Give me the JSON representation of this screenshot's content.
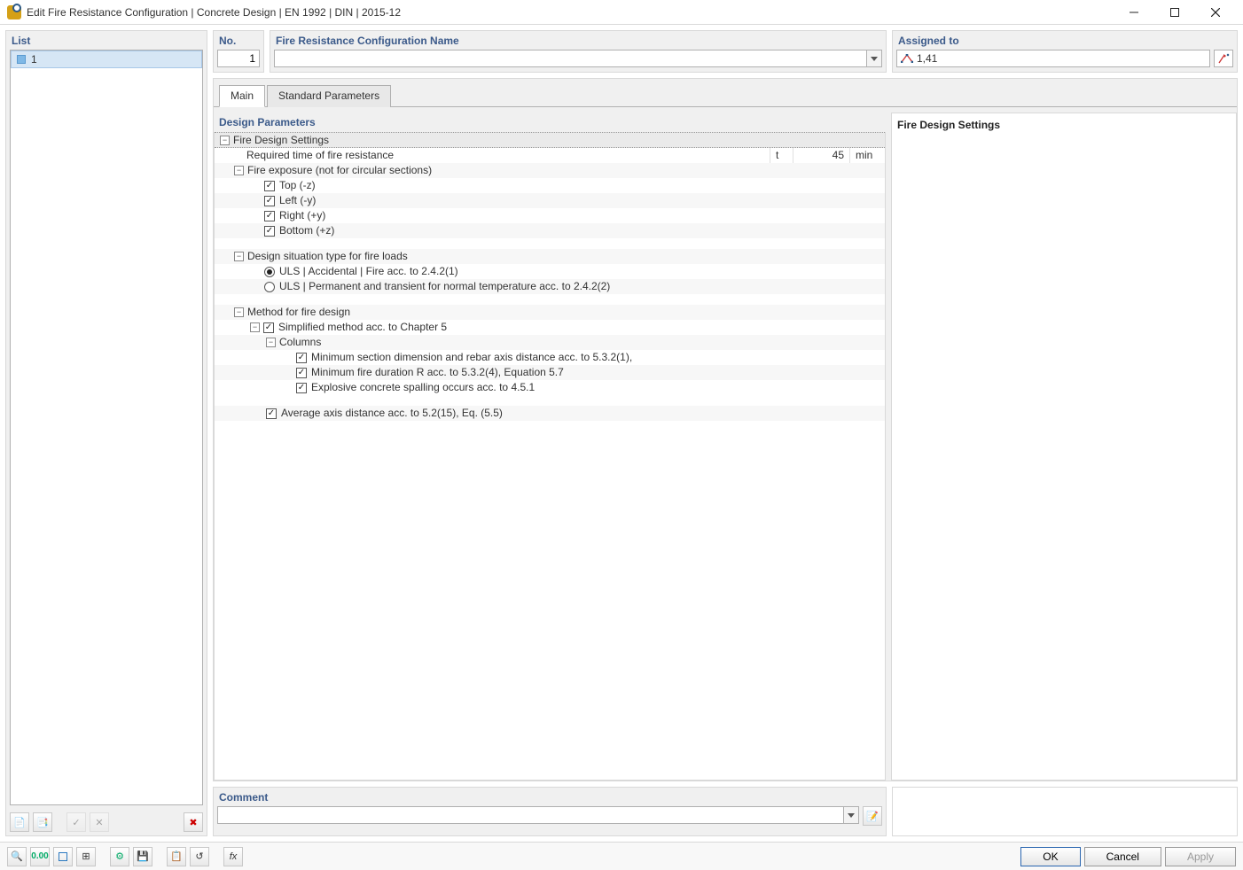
{
  "window": {
    "title": "Edit Fire Resistance Configuration | Concrete Design | EN 1992 | DIN | 2015-12"
  },
  "left": {
    "heading": "List",
    "items": [
      {
        "no": "1"
      }
    ]
  },
  "header": {
    "no_label": "No.",
    "no_value": "1",
    "name_label": "Fire Resistance Configuration Name",
    "name_value": "",
    "assigned_label": "Assigned to",
    "assigned_value": "1,41"
  },
  "tabs": {
    "main": "Main",
    "std": "Standard Parameters"
  },
  "tree": {
    "design_params": "Design Parameters",
    "fire_settings": "Fire Design Settings",
    "req_time_label": "Required time of fire resistance",
    "req_time_sym": "t",
    "req_time_val": "45",
    "req_time_unit": "min",
    "exposure": "Fire exposure (not for circular sections)",
    "top": "Top (-z)",
    "left": "Left (-y)",
    "right": "Right (+y)",
    "bottom": "Bottom (+z)",
    "situation": "Design situation type for fire loads",
    "uls_acc": "ULS | Accidental | Fire acc. to 2.4.2(1)",
    "uls_perm": "ULS | Permanent and transient for normal temperature acc. to 2.4.2(2)",
    "method": "Method for fire design",
    "simplified": "Simplified method acc. to Chapter 5",
    "columns": "Columns",
    "min_section": "Minimum section dimension and rebar axis distance acc. to 5.3.2(1),",
    "min_fire": "Minimum fire duration R acc. to 5.3.2(4), Equation 5.7",
    "explosive": "Explosive concrete spalling occurs acc. to 4.5.1",
    "avg_axis": "Average axis distance acc. to 5.2(15), Eq. (5.5)"
  },
  "right": {
    "heading": "Fire Design Settings"
  },
  "comment": {
    "label": "Comment",
    "value": ""
  },
  "footer": {
    "ok": "OK",
    "cancel": "Cancel",
    "apply": "Apply"
  }
}
